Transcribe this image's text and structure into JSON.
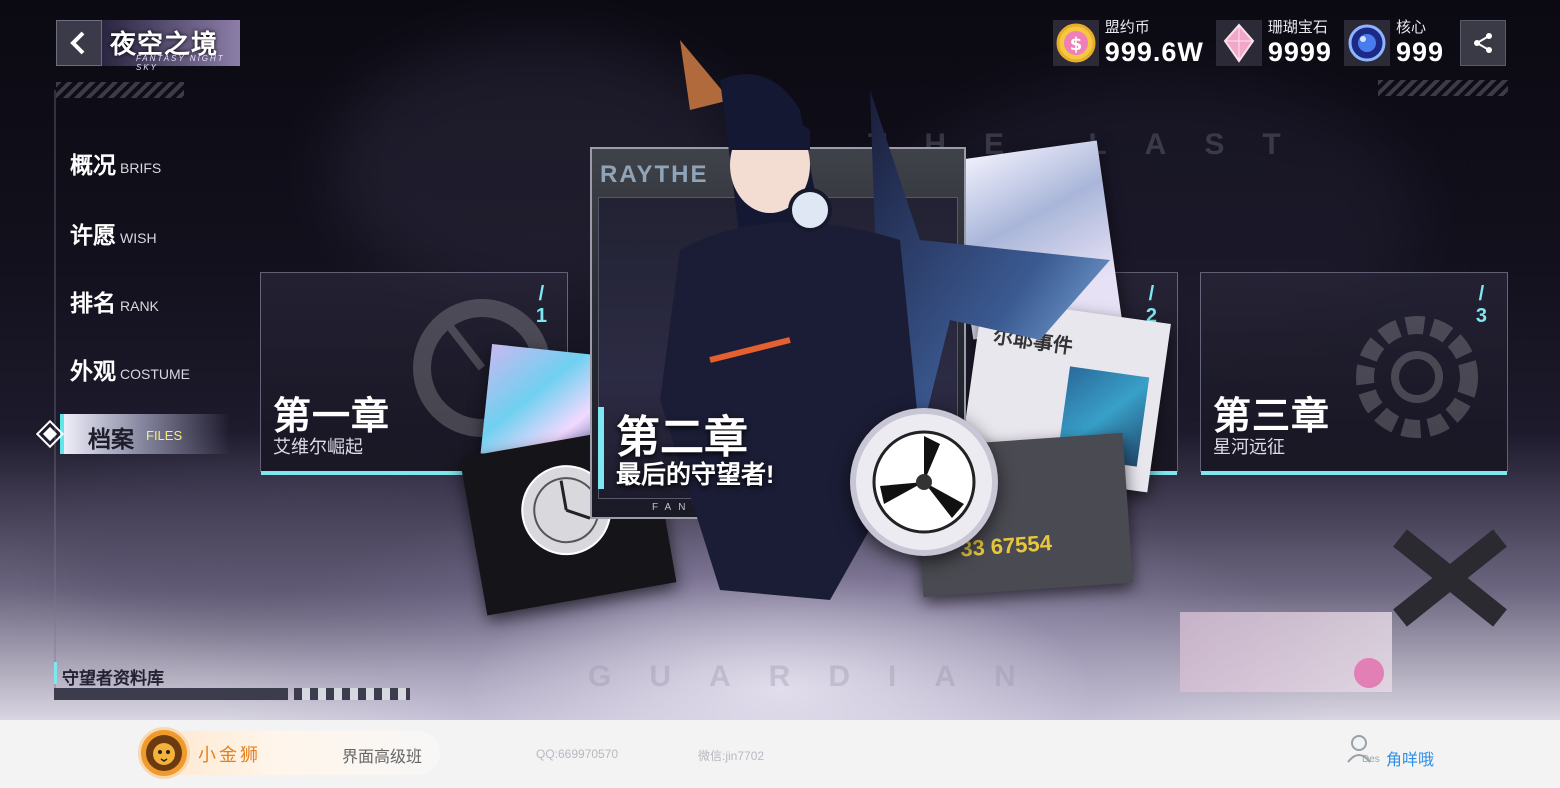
{
  "header": {
    "logo_title": "夜空之境",
    "logo_subtitle": "FANTASY NIGHT SKY"
  },
  "currencies": [
    {
      "label": "盟约币",
      "value": "999.6W",
      "icon": "gold-coin-icon",
      "color": "#f5c842"
    },
    {
      "label": "珊瑚宝石",
      "value": "9999",
      "icon": "pink-gem-icon",
      "color": "#f3a6c8"
    },
    {
      "label": "核心",
      "value": "999",
      "icon": "blue-core-icon",
      "color": "#4a7cf0"
    }
  ],
  "nav": [
    {
      "zh": "概况",
      "en": "BRIFS"
    },
    {
      "zh": "许愿",
      "en": "WISH"
    },
    {
      "zh": "排名",
      "en": "RANK"
    },
    {
      "zh": "外观",
      "en": "COSTUME"
    },
    {
      "zh": "档案",
      "en": "FILES",
      "active": true
    }
  ],
  "chapters": [
    {
      "num": "/\n1",
      "title": "第一章",
      "subtitle": "艾维尔崛起"
    },
    {
      "num": "/\n2",
      "title": "第二章",
      "subtitle": "最后的守望者!"
    },
    {
      "num": "/\n3",
      "title": "第三章",
      "subtitle": "星河远征"
    }
  ],
  "feature": {
    "brand": "RAYTHE",
    "footer": "FANTASY NIGHT SKY"
  },
  "watermarks": {
    "top": "THE LAST",
    "bottom": "GUARDIAN"
  },
  "photos": {
    "doc_title": "尔耶事件",
    "number": "33 67554"
  },
  "library": {
    "title": "守望者资料库"
  },
  "footer": {
    "brand_name": "小金狮",
    "brand_class": "界面高级班",
    "qq": "QQ:669970570",
    "wechat": "微信:jin7702",
    "user_des": "Des",
    "user_name": "角咩哦"
  },
  "colors": {
    "accent": "#7ee7f0",
    "active_nav_en": "#f3f07a"
  }
}
